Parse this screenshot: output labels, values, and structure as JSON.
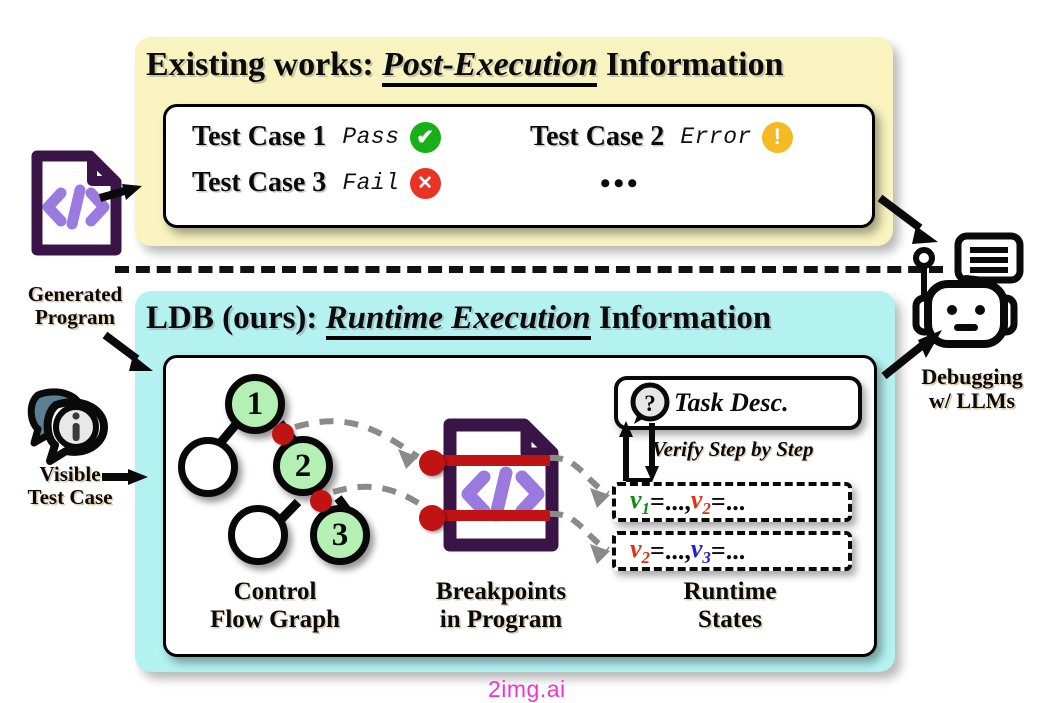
{
  "top_panel": {
    "title_prefix": "Existing works: ",
    "title_emph": "Post-Execution",
    "title_suffix": " Information",
    "bg_color": "#f8f3bf",
    "tests": [
      {
        "label": "Test Case 1",
        "status": "Pass",
        "badge": "check-icon",
        "badge_color": "#18b018",
        "glyph": "✔"
      },
      {
        "label": "Test Case 3",
        "status": "Fail",
        "badge": "cross-icon",
        "badge_color": "#ea3323",
        "glyph": "✕"
      },
      {
        "label": "Test Case 2",
        "status": "Error",
        "badge": "warning-icon",
        "badge_color": "#f5b921",
        "glyph": "!"
      },
      {
        "label": "",
        "status": "",
        "badge": "",
        "ellipsis": "•••"
      }
    ]
  },
  "bottom_panel": {
    "title_prefix": "LDB (ours): ",
    "title_emph": "Runtime Execution",
    "title_suffix": " Information",
    "bg_color": "#b4f2f2",
    "captions": [
      {
        "line1": "Control",
        "line2": "Flow Graph"
      },
      {
        "line1": "Breakpoints",
        "line2": "in Program"
      },
      {
        "line1": "Runtime",
        "line2": "States"
      }
    ],
    "cfg": {
      "nodes": [
        {
          "label": "1",
          "fill": "#b4f0b4"
        },
        {
          "label": "2",
          "fill": "#b4f0b4"
        },
        {
          "label": "3",
          "fill": "#b4f0b4"
        },
        {
          "label": "",
          "fill": "#ffffff"
        },
        {
          "label": "",
          "fill": "#ffffff"
        }
      ],
      "breakpoint_color": "#c01414"
    },
    "program_icon": {
      "name": "code-document-icon",
      "outline_color": "#3b1447",
      "code_color": "#9b7ae0",
      "breakpoint_color": "#c01414",
      "glyph": "</>"
    },
    "task": {
      "icon": "question-bubble-icon",
      "icon_glyph": "?",
      "label": "Task Desc."
    },
    "verify_label": "Verify Step by Step",
    "states": [
      {
        "vars": [
          {
            "name": "v",
            "sub": "1",
            "color": "#108c10",
            "value": "=..., "
          },
          {
            "name": "v",
            "sub": "2",
            "color": "#e33015",
            "value": "=..."
          }
        ]
      },
      {
        "vars": [
          {
            "name": "v",
            "sub": "2",
            "color": "#e33015",
            "value": "=..., "
          },
          {
            "name": "v",
            "sub": "3",
            "color": "#2020d8",
            "value": "=..."
          }
        ]
      }
    ]
  },
  "left_rail": {
    "generated_program": {
      "icon": "code-document-icon",
      "line1": "Generated",
      "line2": "Program",
      "outline_color": "#3b1447",
      "code_color": "#9b7ae0"
    },
    "visible_test_case": {
      "icon": "info-bubble-icon",
      "icon_glyph": "i",
      "line1": "Visible",
      "line2": "Test Case"
    }
  },
  "right_rail": {
    "robot": {
      "icon": "robot-llm-icon",
      "line1": "Debugging",
      "line2": "w/ LLMs"
    }
  },
  "watermark": "2img.ai"
}
